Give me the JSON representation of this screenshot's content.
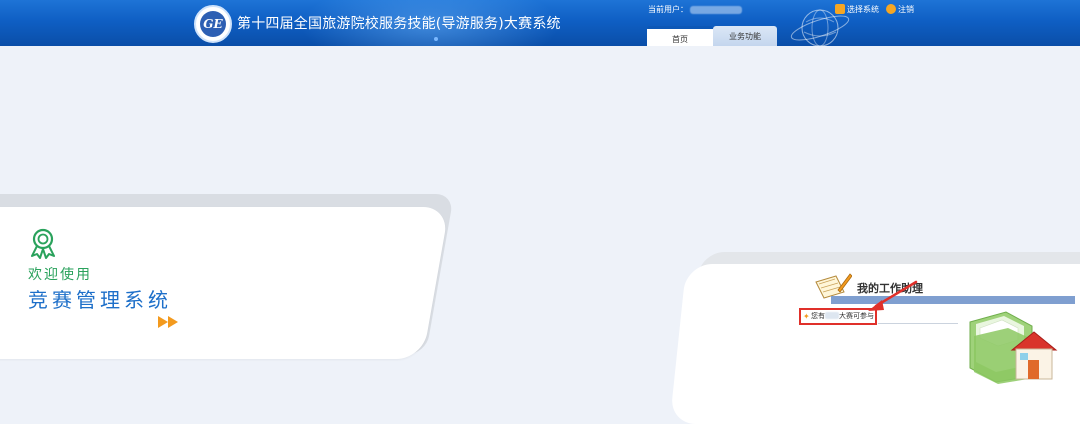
{
  "header": {
    "title": "第十四届全国旅游院校服务技能(导游服务)大赛系统",
    "logo_text": "GE",
    "current_user_label": "当前用户：",
    "tabs": [
      {
        "label": "首页",
        "active": true
      },
      {
        "label": "业务功能",
        "active": false
      }
    ],
    "links": [
      {
        "label": "选择系统",
        "icon": "switch-icon"
      },
      {
        "label": "注销",
        "icon": "logout-icon"
      }
    ],
    "colors": {
      "bar": "#0f5fc4",
      "icon_accent": "#f5a623"
    }
  },
  "welcome": {
    "line1": "欢迎使用",
    "line2": "竞赛管理系统",
    "icon": "award-ribbon-icon",
    "colors": {
      "line1": "#2aa25c",
      "line2": "#1d6fc9",
      "arrow": "#f39a1e"
    }
  },
  "assistant": {
    "title": "我的工作助理",
    "notice_prefix": "您有",
    "notice_suffix": "大赛可参与",
    "icon": "notepad-pencil-icon",
    "image": "home-folder-icon",
    "colors": {
      "highlight": "#e0302a",
      "bar": "#7f9fd0"
    }
  }
}
